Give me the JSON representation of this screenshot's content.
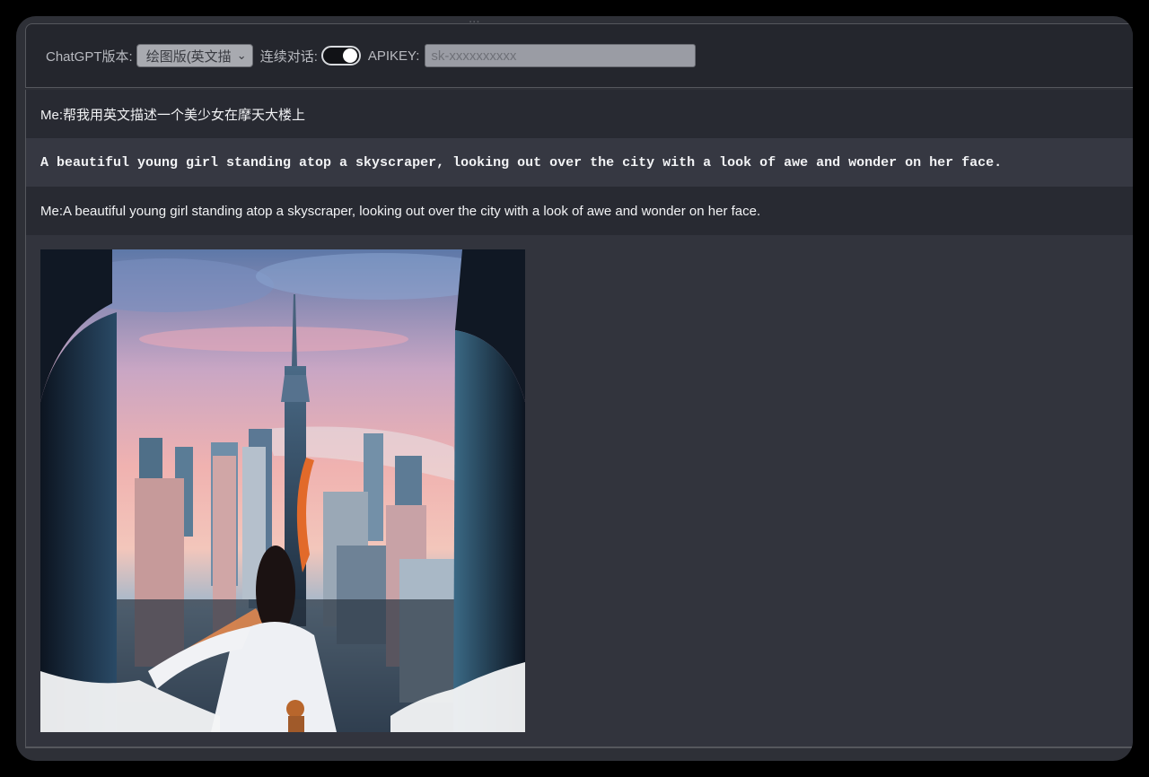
{
  "top_strip_text": "...",
  "toolbar": {
    "version_label": "ChatGPT版本:",
    "version_value": "绘图版(英文描",
    "continuous_label": "连续对话:",
    "apikey_label": "APIKEY:",
    "apikey_placeholder": "sk-xxxxxxxxxx"
  },
  "messages": [
    {
      "role": "user",
      "prefix": "Me:",
      "text": "帮我用英文描述一个美少女在摩天大楼上"
    },
    {
      "role": "assistant",
      "text": "A beautiful young girl standing atop a skyscraper, looking out over the city with a look of awe and wonder on her face."
    },
    {
      "role": "user",
      "prefix": "Me:",
      "text": "A beautiful young girl standing atop a skyscraper, looking out over the city with a look of awe and wonder on her face."
    }
  ],
  "colors": {
    "background": "#000000",
    "panel": "#2e3037",
    "toolbar": "#24262d",
    "user_row": "#282a32",
    "assistant_row": "#363842",
    "text": "#f2f3f5"
  },
  "toggle_on": true
}
